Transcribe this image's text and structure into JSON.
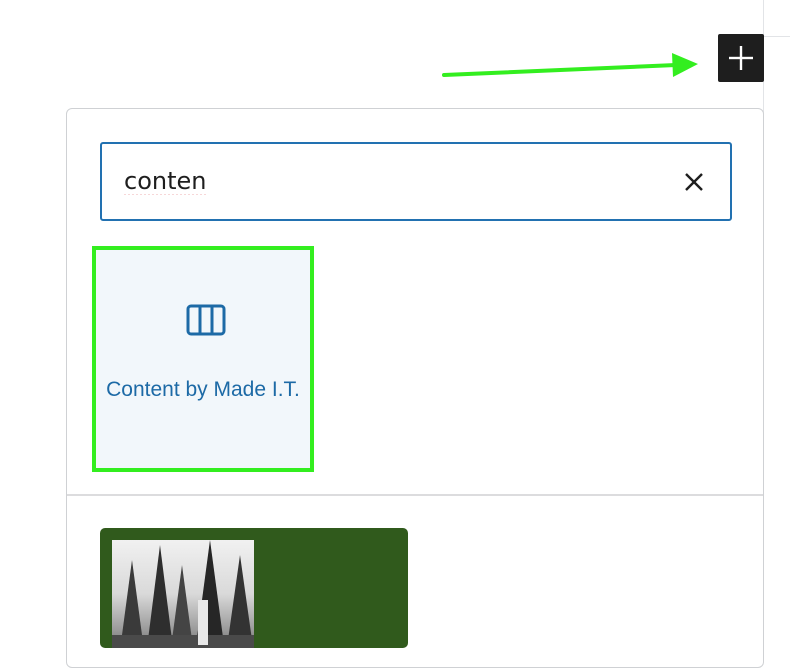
{
  "toolbar": {
    "add_button_icon": "plus-icon"
  },
  "inserter": {
    "search": {
      "value": "conten",
      "clear_icon": "close-icon"
    },
    "results": [
      {
        "label": "Content by Made I.T.",
        "icon": "columns-icon",
        "highlighted": true
      }
    ],
    "patterns": [
      {
        "preview": "forest-image",
        "background_color": "#305a1c"
      }
    ]
  },
  "annotations": {
    "highlight_color": "#33ee1f",
    "arrow_target": "add-block-button"
  },
  "colors": {
    "accent": "#2271b1",
    "block_label": "#1d6aa6",
    "button_dark": "#1e1e1e"
  }
}
